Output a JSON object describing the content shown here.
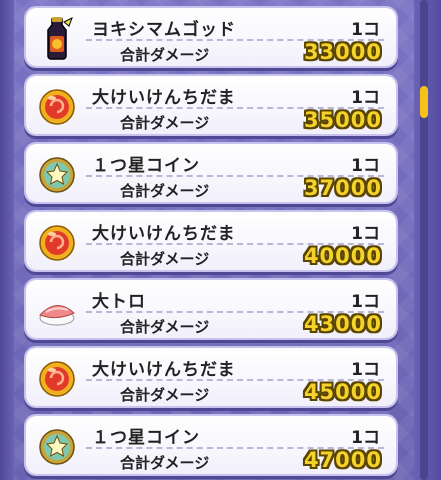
{
  "damage_label": "合計ダメージ",
  "rows": [
    {
      "icon": "sake-bottle-icon",
      "name": "ヨキシマムゴッド",
      "qty": "1コ",
      "damage": "33000"
    },
    {
      "icon": "red-orb-icon",
      "name": "大けいけんちだま",
      "qty": "1コ",
      "damage": "35000"
    },
    {
      "icon": "star-coin-icon",
      "name": "１つ星コイン",
      "qty": "1コ",
      "damage": "37000"
    },
    {
      "icon": "red-orb-icon",
      "name": "大けいけんちだま",
      "qty": "1コ",
      "damage": "40000"
    },
    {
      "icon": "tuna-sushi-icon",
      "name": "大トロ",
      "qty": "1コ",
      "damage": "43000"
    },
    {
      "icon": "red-orb-icon",
      "name": "大けいけんちだま",
      "qty": "1コ",
      "damage": "45000"
    },
    {
      "icon": "star-coin-icon",
      "name": "１つ星コイン",
      "qty": "1コ",
      "damage": "47000"
    }
  ],
  "colors": {
    "background": "#6f68b8",
    "row_background": "#ffffff",
    "damage_number": "#f5d22a",
    "scroll_thumb": "#f6c21a"
  },
  "scroll_position": 0.18
}
